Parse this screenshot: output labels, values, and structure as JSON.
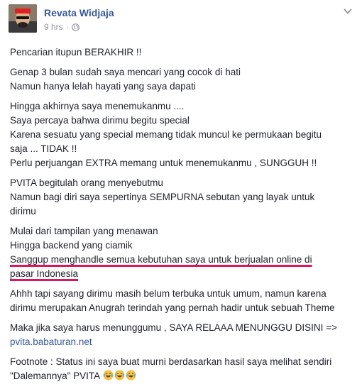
{
  "post": {
    "author": "Revata Widjaja",
    "time": "9 hrs",
    "separator": "·",
    "privacy_icon": "globe-icon",
    "menu_icon": "chevron-down-icon",
    "paragraphs": [
      [
        "Pencarian itupun BERAKHIR !!"
      ],
      [
        "Genap 3 bulan sudah saya mencari yang cocok di hati",
        "Namun hanya lelah hayati yang saya dapati"
      ],
      [
        "Hingga akhirnya saya menemukanmu ....",
        "Saya percaya bahwa dirimu begitu special",
        "Karena sesuatu yang special memang tidak muncul ke permukaan begitu",
        "saja ... TIDAK !!",
        "Perlu perjuangan EXTRA memang untuk menemukanmu , SUNGGUH !!"
      ],
      [
        "PVITA begitulah orang menyebutmu",
        "Namun bagi diri saya sepertinya SEMPURNA sebutan yang layak untuk",
        "dirimu"
      ],
      [
        "Mulai dari tampilan yang menawan",
        "Hingga backend yang ciamik"
      ],
      [
        "Ahhh tapi sayang dirimu masih belum terbuka untuk umum, namun karena",
        "dirimu merupakan Anugrah terindah yang pernah hadir untuk sebuah Theme"
      ],
      [
        "Maka jika saya harus menunggumu , SAYA RELAAA MENUNGGU DISINI =>"
      ],
      [
        "Footnote : Status ini saya buat murni berdasarkan hasil saya melihat sendiri",
        "\"Dalemannya\" PVITA"
      ]
    ],
    "highlight_lines": [
      "Sanggup menghandle semua kebutuhan saya untuk berjualan online di",
      "pasar Indonesia"
    ],
    "link_text": "pvita.babaturan.net",
    "emoji_icon": "laughing-tears-emoji-icon",
    "colors": {
      "author": "#365899",
      "meta": "#90949c",
      "text": "#1d2129",
      "highlight_underline": "#e0155b"
    }
  }
}
